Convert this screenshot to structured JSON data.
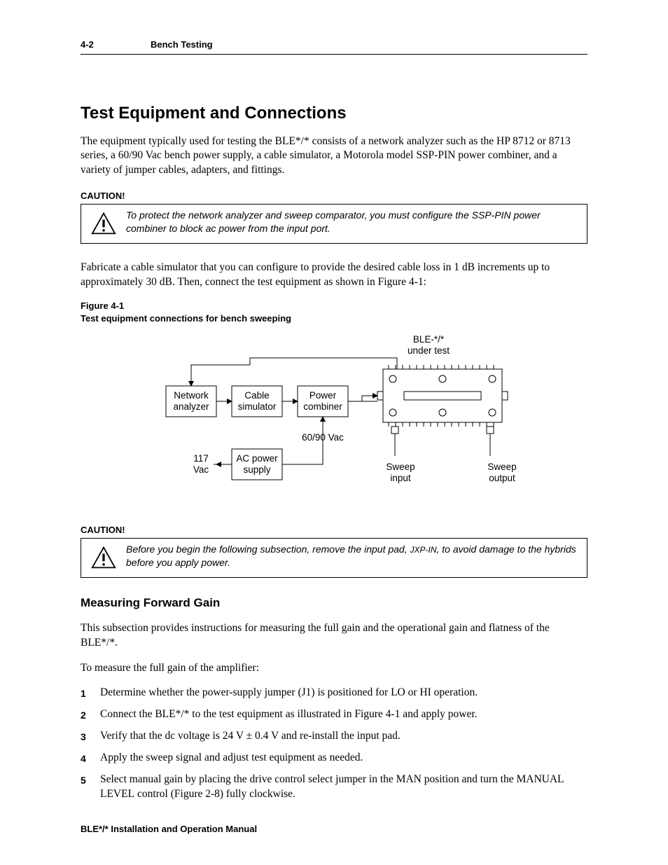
{
  "header": {
    "page_number": "4-2",
    "section": "Bench Testing"
  },
  "title": "Test Equipment and Connections",
  "intro_paragraph": "The equipment typically used for testing the BLE*/* consists of a network analyzer such as the HP 8712 or 8713 series, a 60/90 Vac bench power supply, a cable simulator, a Motorola model SSP-PIN power combiner, and a variety of jumper cables, adapters, and fittings.",
  "caution1": {
    "label": "CAUTION!",
    "text": "To protect the network analyzer and sweep comparator, you must configure the SSP-PIN power combiner to block ac power from the input port."
  },
  "fabricate_paragraph": "Fabricate a cable simulator that you can configure to provide the desired cable loss in 1 dB increments up to approximately 30 dB. Then, connect the test equipment as shown in Figure 4-1:",
  "figure": {
    "label_line1": "Figure 4-1",
    "label_line2": "Test equipment connections for bench sweeping",
    "labels": {
      "device": "BLE-*/*",
      "device_sub": "under test",
      "network_analyzer_l1": "Network",
      "network_analyzer_l2": "analyzer",
      "cable_simulator_l1": "Cable",
      "cable_simulator_l2": "simulator",
      "power_combiner_l1": "Power",
      "power_combiner_l2": "combiner",
      "ac_supply_l1": "AC power",
      "ac_supply_l2": "supply",
      "v117_l1": "117",
      "v117_l2": "Vac",
      "v6090": "60/90 Vac",
      "sweep_in_l1": "Sweep",
      "sweep_in_l2": "input",
      "sweep_out_l1": "Sweep",
      "sweep_out_l2": "output"
    }
  },
  "caution2": {
    "label": "CAUTION!",
    "text_before": "Before you begin the following subsection, remove the input pad, ",
    "text_sc": "JXP-IN",
    "text_after": ", to avoid damage to the hybrids before you apply power."
  },
  "subsection": {
    "title": "Measuring Forward Gain",
    "intro": "This subsection provides instructions for measuring the full gain and the operational gain and flatness of the BLE*/*.",
    "lead": "To measure the full gain of the amplifier:",
    "steps": {
      "s1_before": "Determine whether the power-supply jumper (J1) is positioned for ",
      "s1_sc1": "LO",
      "s1_mid": " or ",
      "s1_sc2": "HI",
      "s1_after": " operation.",
      "s2": "Connect the BLE*/* to the test equipment as illustrated in Figure 4-1 and apply power.",
      "s3": "Verify that the dc voltage is 24 V ± 0.4 V and re-install the input pad.",
      "s4": "Apply the sweep signal and adjust test equipment as needed.",
      "s5_before": "Select manual gain by placing the drive control select jumper in the ",
      "s5_sc1": "MAN",
      "s5_mid": " position and turn the ",
      "s5_sc2": "MANUAL LEVEL",
      "s5_after": " control (Figure 2-8) fully clockwise."
    }
  },
  "footer": "BLE*/* Installation and Operation Manual"
}
